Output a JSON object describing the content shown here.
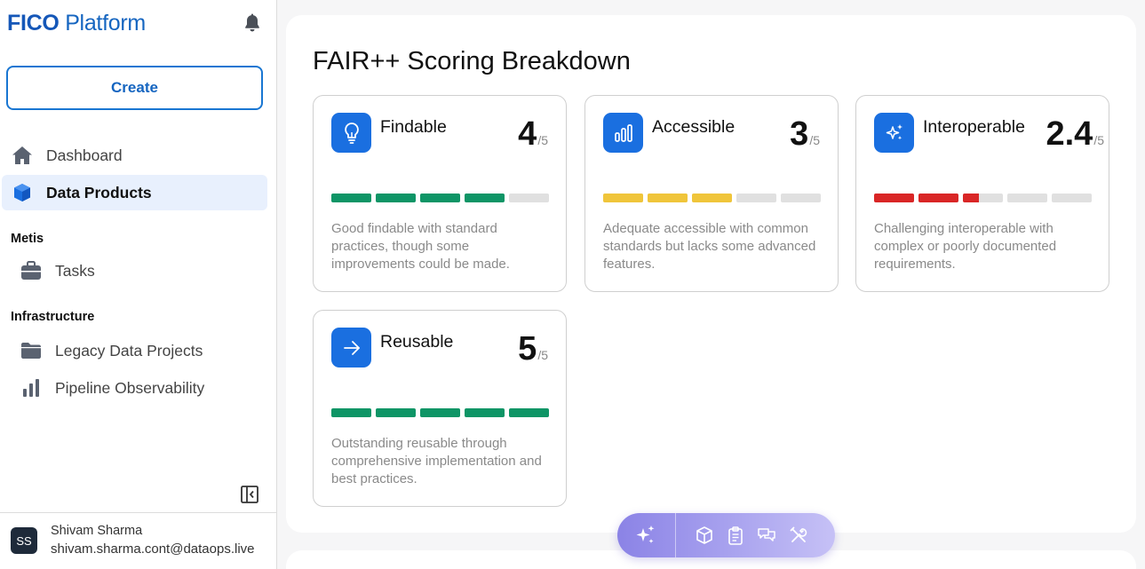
{
  "app": {
    "brand_bold": "FICO",
    "brand_rest": "Platform"
  },
  "sidebar": {
    "create_label": "Create",
    "nav": [
      {
        "label": "Dashboard",
        "icon": "home-icon"
      },
      {
        "label": "Data Products",
        "icon": "cube-icon",
        "active": true
      }
    ],
    "sections": [
      {
        "title": "Metis",
        "items": [
          {
            "label": "Tasks",
            "icon": "briefcase-icon"
          }
        ]
      },
      {
        "title": "Infrastructure",
        "items": [
          {
            "label": "Legacy Data Projects",
            "icon": "folder-icon"
          },
          {
            "label": "Pipeline Observability",
            "icon": "bar-chart-icon"
          }
        ]
      }
    ]
  },
  "user": {
    "initials": "SS",
    "name": "Shivam Sharma",
    "email": "shivam.sharma.cont@dataops.live"
  },
  "main": {
    "heading": "FAIR++ Scoring Breakdown",
    "cards": [
      {
        "title": "Findable",
        "score": "4",
        "max": "/5",
        "value": 4,
        "color": "#0e9566",
        "icon": "lightbulb-icon",
        "desc": "Good findable with standard practices, though some improvements could be made."
      },
      {
        "title": "Accessible",
        "score": "3",
        "max": "/5",
        "value": 3,
        "color": "#f0c53a",
        "icon": "signal-bars-icon",
        "desc": "Adequate accessible with common standards but lacks some advanced features."
      },
      {
        "title": "Interoperable",
        "score": "2.4",
        "max": "/5",
        "value": 2.4,
        "color": "#d92626",
        "icon": "sparkles-icon",
        "desc": "Challenging interoperable with complex or poorly documented requirements."
      },
      {
        "title": "Reusable",
        "score": "5",
        "max": "/5",
        "value": 5,
        "color": "#0e9566",
        "icon": "arrow-right-icon",
        "desc": "Outstanding reusable through comprehensive implementation and best practices."
      }
    ]
  },
  "toolbar": {
    "icons": [
      "sparkles-icon",
      "cube-icon",
      "clipboard-icon",
      "chat-icon",
      "tools-icon"
    ]
  }
}
